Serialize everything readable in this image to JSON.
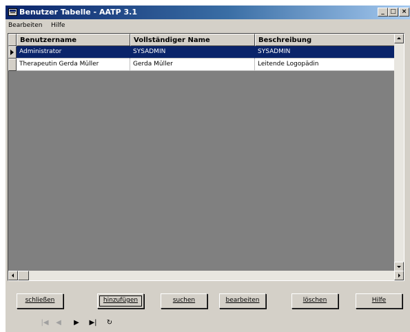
{
  "window": {
    "title": "Benutzer Tabelle - AATP 3.1",
    "controls": {
      "minimize": "_",
      "maximize": "□",
      "close": "×"
    }
  },
  "menu": {
    "items": [
      "Bearbeiten",
      "Hilfe"
    ]
  },
  "table": {
    "columns": [
      "Benutzername",
      "Vollständiger Name",
      "Beschreibung"
    ],
    "rows": [
      {
        "username": "Administrator",
        "full_name": "SYSADMIN",
        "description": "SYSADMIN",
        "selected": true
      },
      {
        "username": "Therapeutin Gerda Müller",
        "full_name": "Gerda Müller",
        "description": "Leitende Logopädin",
        "selected": false
      }
    ]
  },
  "buttons": {
    "close": "schließen",
    "add": "hinzufügen",
    "search": "suchen",
    "edit": "bearbeiten",
    "delete": "löschen",
    "help": "Hilfe"
  },
  "nav": {
    "first": "|◀",
    "prev": "◀",
    "next": "▶",
    "last": "▶|",
    "refresh": "↻"
  },
  "colors": {
    "selection": "#0a246a",
    "face": "#d4d0c8",
    "grid_bg": "#808080"
  }
}
